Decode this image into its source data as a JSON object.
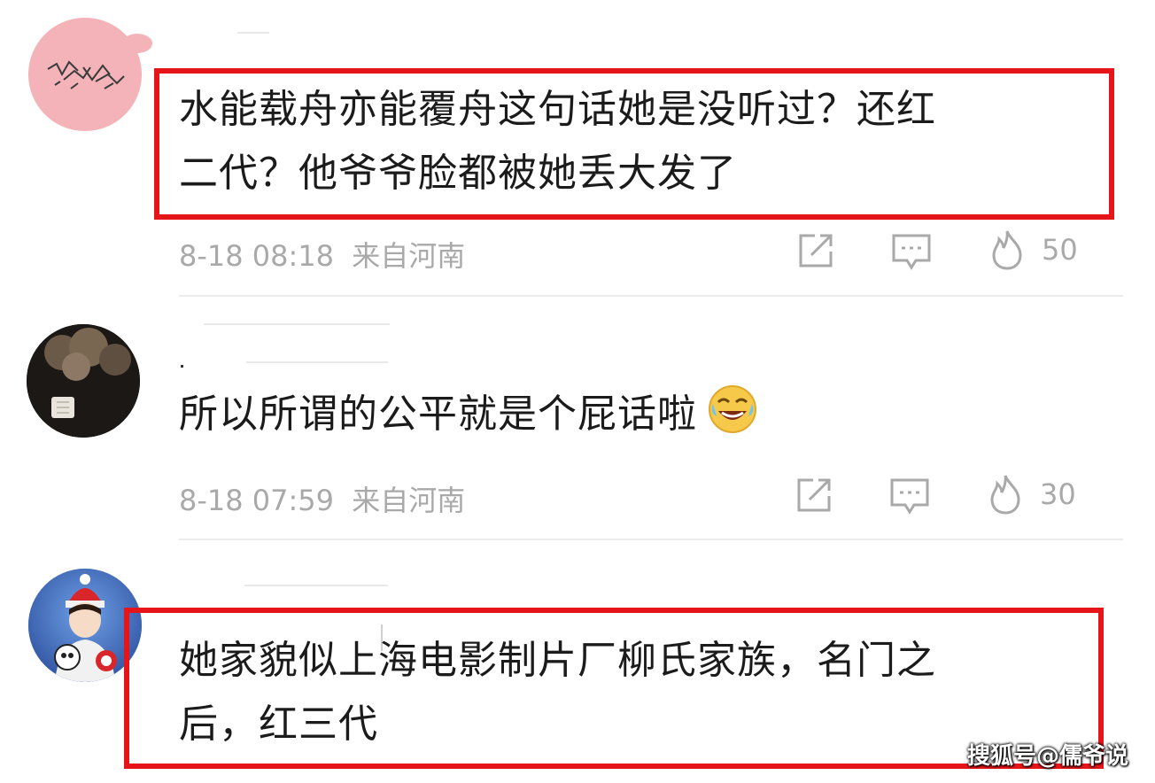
{
  "comments": [
    {
      "text_line1": "水能载舟亦能覆舟这句话她是没听过？还红",
      "text_line2": "二代？他爷爷脸都被她丢大发了",
      "date": "8-18 08:18",
      "location": "来自河南",
      "likes": "50",
      "highlighted": true
    },
    {
      "text_line1": "所以所谓的公平就是个屁话啦",
      "date": "8-18 07:59",
      "location": "来自河南",
      "likes": "30",
      "highlighted": false
    },
    {
      "text_line1": "她家貌似上海电影制片厂柳氏家族，名门之",
      "text_line2": "后，红三代",
      "highlighted": true
    }
  ],
  "watermark": "搜狐号@儒爷说",
  "colors": {
    "highlight": "#e5151a",
    "meta_text": "#a9a9a9",
    "body_text": "#1b1b1b"
  },
  "icons": [
    "share-icon",
    "comment-icon",
    "like-fire-icon",
    "laughing-crying-emoji"
  ]
}
